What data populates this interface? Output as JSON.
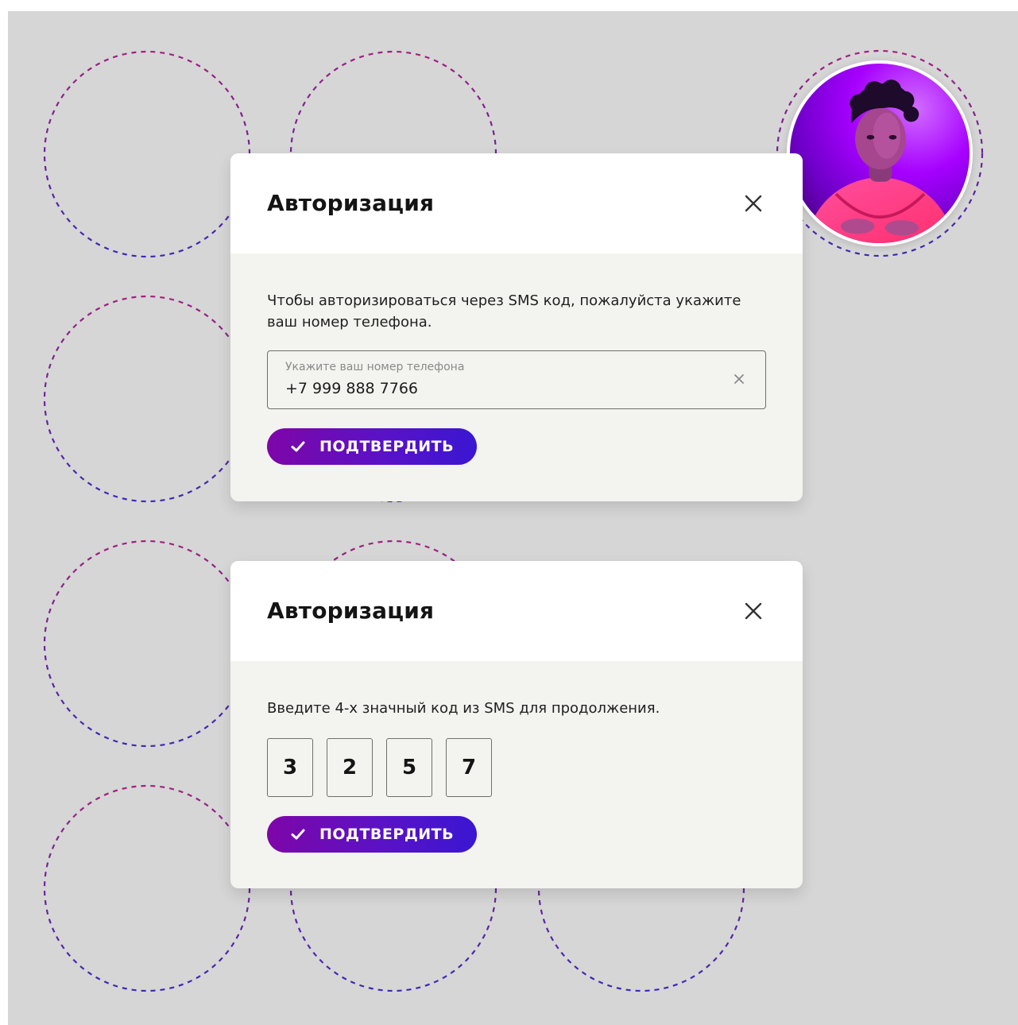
{
  "colors": {
    "background": "#d6d6d6",
    "modal_header": "#ffffff",
    "modal_body": "#f3f3ef",
    "button_gradient_start": "#7e06a8",
    "button_gradient_end": "#3a16d2",
    "dashed_pink": "#a0217f",
    "dashed_blue": "#3a28b8"
  },
  "phone_modal": {
    "title": "Авторизация",
    "description": "Чтобы авторизироваться через SMS код, пожалуйста укажите ваш номер телефона.",
    "phone_field": {
      "label": "Укажите ваш номер телефона",
      "value": "+7 999 888 7766"
    },
    "confirm_label": "ПОДТВЕРДИТЬ",
    "close_icon": "close-icon",
    "clear_icon": "clear-icon",
    "check_icon": "check-icon"
  },
  "code_modal": {
    "title": "Авторизация",
    "description": "Введите 4-х значный код из SMS для продолжения.",
    "code_digits": [
      "3",
      "2",
      "5",
      "7"
    ],
    "confirm_label": "ПОДТВЕРДИТЬ",
    "close_icon": "close-icon",
    "check_icon": "check-icon"
  },
  "avatar": {
    "icon": "user-avatar"
  }
}
